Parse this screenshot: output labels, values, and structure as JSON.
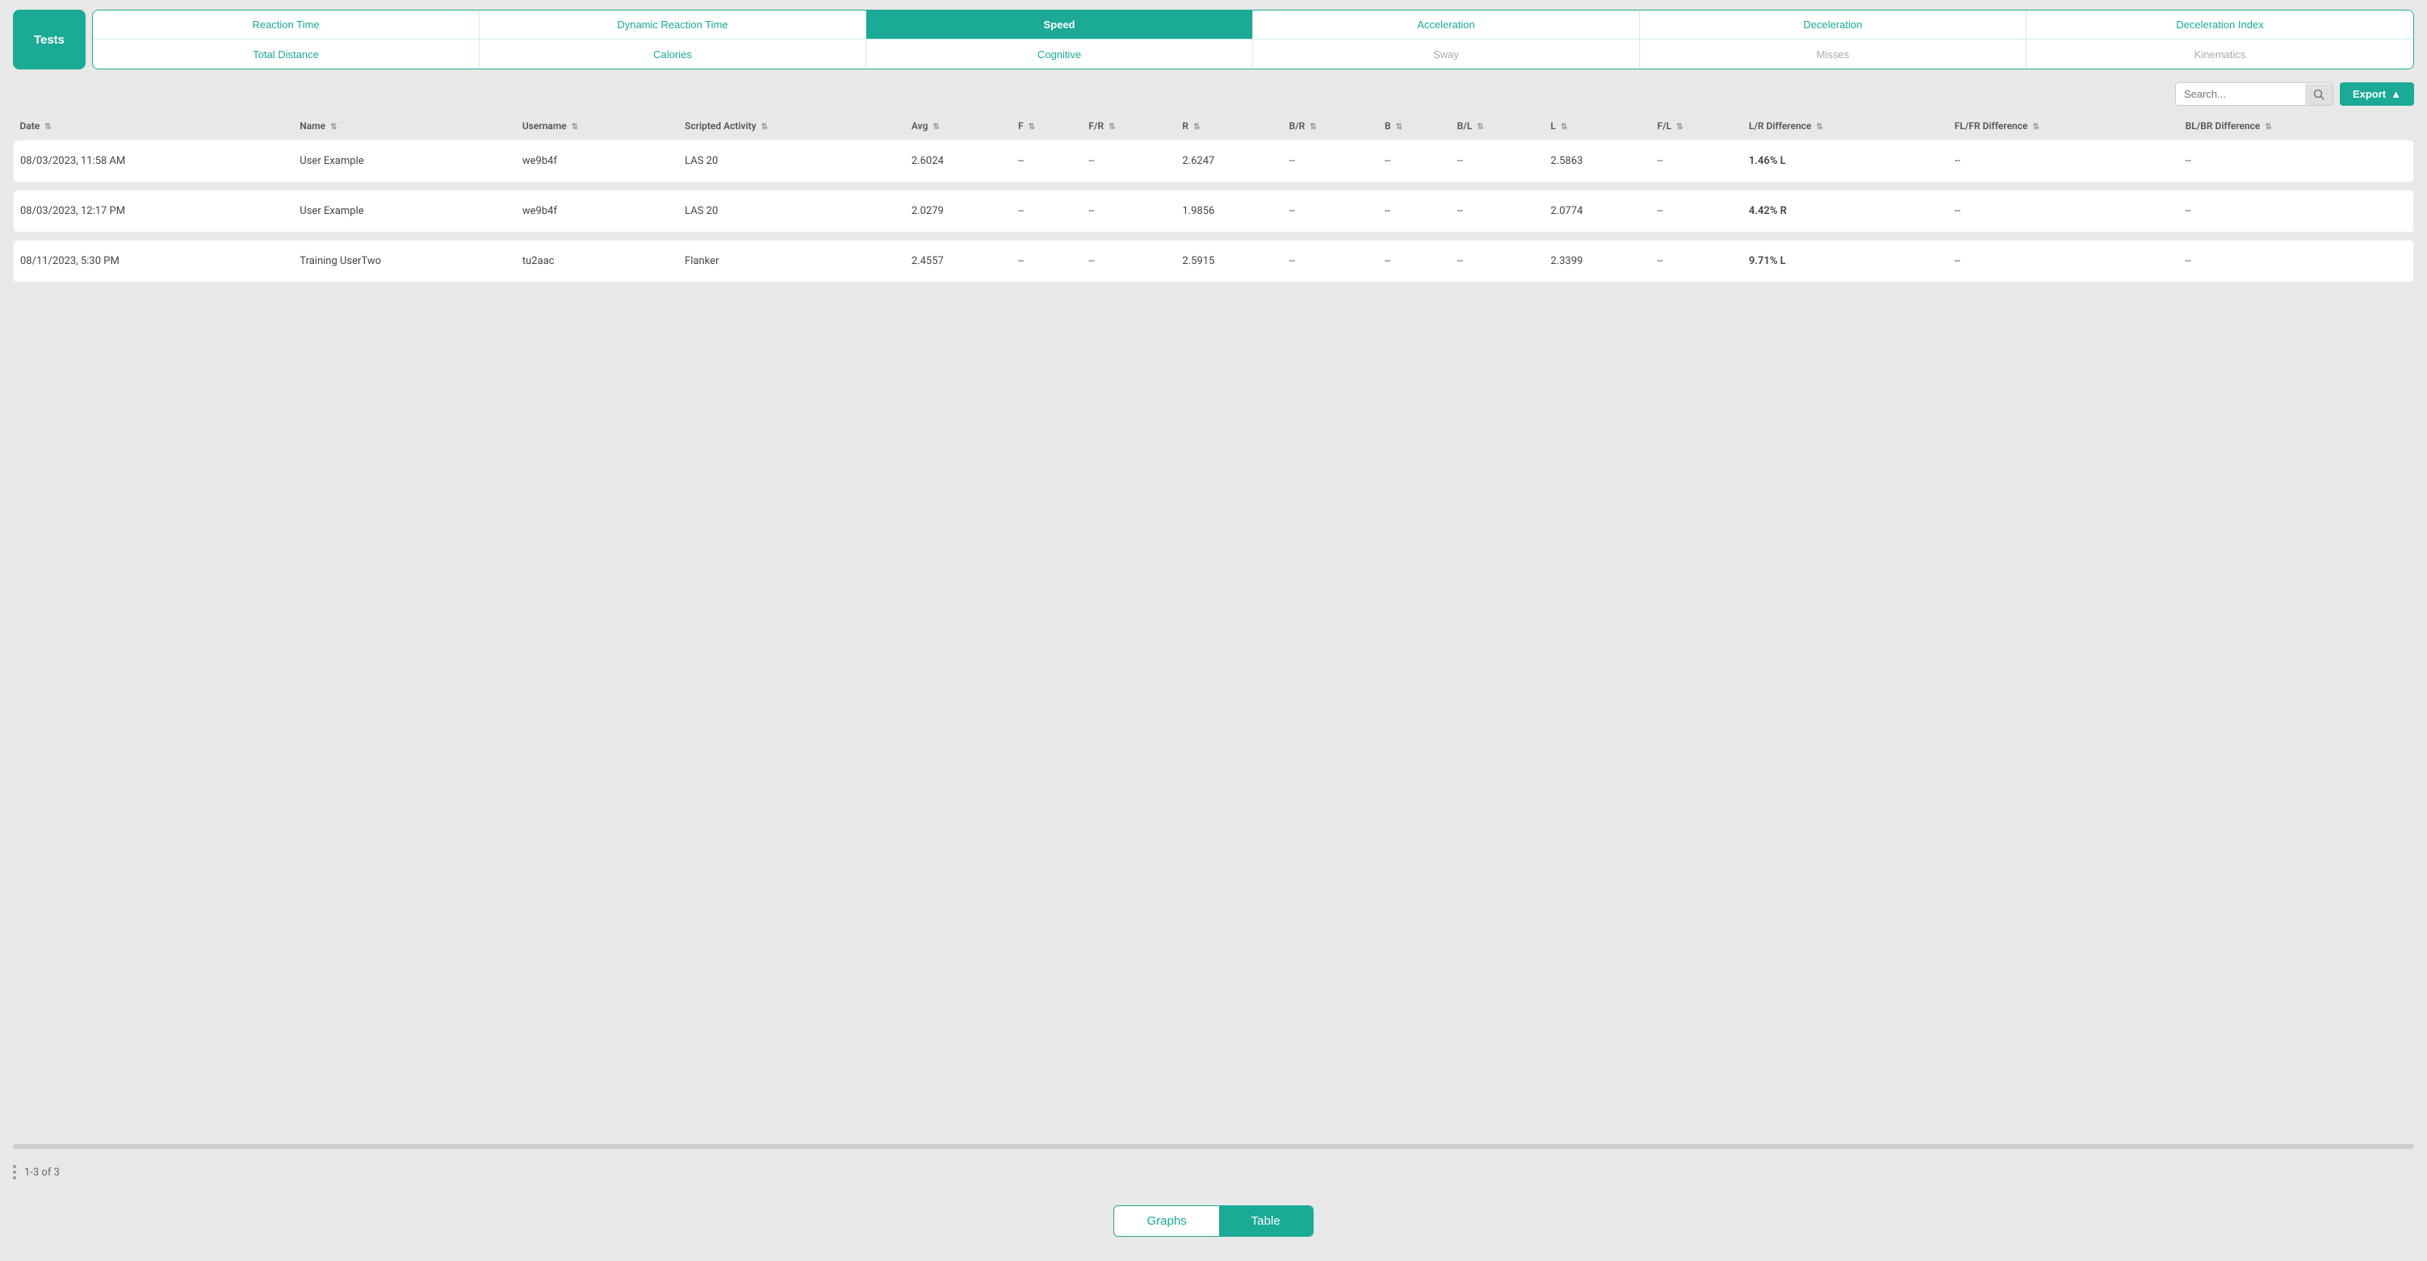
{
  "tests_label": "Tests",
  "tabs": {
    "row1": [
      {
        "id": "reaction-time",
        "label": "Reaction Time",
        "active": false,
        "disabled": false
      },
      {
        "id": "dynamic-reaction-time",
        "label": "Dynamic Reaction Time",
        "active": false,
        "disabled": false
      },
      {
        "id": "speed",
        "label": "Speed",
        "active": true,
        "disabled": false
      },
      {
        "id": "acceleration",
        "label": "Acceleration",
        "active": false,
        "disabled": false
      },
      {
        "id": "deceleration",
        "label": "Deceleration",
        "active": false,
        "disabled": false
      },
      {
        "id": "deceleration-index",
        "label": "Deceleration Index",
        "active": false,
        "disabled": false
      }
    ],
    "row2": [
      {
        "id": "total-distance",
        "label": "Total Distance",
        "active": false,
        "disabled": false
      },
      {
        "id": "calories",
        "label": "Calories",
        "active": false,
        "disabled": false
      },
      {
        "id": "cognitive",
        "label": "Cognitive",
        "active": false,
        "disabled": false
      },
      {
        "id": "sway",
        "label": "Sway",
        "active": false,
        "disabled": true
      },
      {
        "id": "misses",
        "label": "Misses",
        "active": false,
        "disabled": true
      },
      {
        "id": "kinematics",
        "label": "Kinematics",
        "active": false,
        "disabled": true
      }
    ]
  },
  "toolbar": {
    "search_placeholder": "Search...",
    "export_label": "Export"
  },
  "table": {
    "columns": [
      {
        "id": "date",
        "label": "Date"
      },
      {
        "id": "name",
        "label": "Name"
      },
      {
        "id": "username",
        "label": "Username"
      },
      {
        "id": "scripted-activity",
        "label": "Scripted Activity"
      },
      {
        "id": "avg",
        "label": "Avg"
      },
      {
        "id": "f",
        "label": "F"
      },
      {
        "id": "fr",
        "label": "F/R"
      },
      {
        "id": "r",
        "label": "R"
      },
      {
        "id": "br",
        "label": "B/R"
      },
      {
        "id": "b",
        "label": "B"
      },
      {
        "id": "bl",
        "label": "B/L"
      },
      {
        "id": "l",
        "label": "L"
      },
      {
        "id": "fl",
        "label": "F/L"
      },
      {
        "id": "lr-difference",
        "label": "L/R Difference"
      },
      {
        "id": "flfr-difference",
        "label": "FL/FR Difference"
      },
      {
        "id": "blbr-difference",
        "label": "BL/BR Difference"
      }
    ],
    "rows": [
      {
        "date": "08/03/2023, 11:58 AM",
        "name": "User Example",
        "username": "we9b4f",
        "scripted_activity": "LAS 20",
        "avg": "2.6024",
        "f": "--",
        "fr": "--",
        "r": "2.6247",
        "br": "--",
        "b": "--",
        "bl": "--",
        "l": "2.5863",
        "fl": "--",
        "lr_difference": "1.46% L",
        "lr_difference_highlight": true,
        "flfr_difference": "--",
        "blbr_difference": "--"
      },
      {
        "date": "08/03/2023, 12:17 PM",
        "name": "User Example",
        "username": "we9b4f",
        "scripted_activity": "LAS 20",
        "avg": "2.0279",
        "f": "--",
        "fr": "--",
        "r": "1.9856",
        "br": "--",
        "b": "--",
        "bl": "--",
        "l": "2.0774",
        "fl": "--",
        "lr_difference": "4.42% R",
        "lr_difference_highlight": true,
        "flfr_difference": "--",
        "blbr_difference": "--"
      },
      {
        "date": "08/11/2023, 5:30 PM",
        "name": "Training UserTwo",
        "username": "tu2aac",
        "scripted_activity": "Flanker",
        "avg": "2.4557",
        "f": "--",
        "fr": "--",
        "r": "2.5915",
        "br": "--",
        "b": "--",
        "bl": "--",
        "l": "2.3399",
        "fl": "--",
        "lr_difference": "9.71% L",
        "lr_difference_highlight": true,
        "flfr_difference": "--",
        "blbr_difference": "--"
      }
    ]
  },
  "pagination": {
    "label": "1-3 of 3"
  },
  "bottom_toggle": {
    "graphs_label": "Graphs",
    "table_label": "Table",
    "active": "table"
  }
}
